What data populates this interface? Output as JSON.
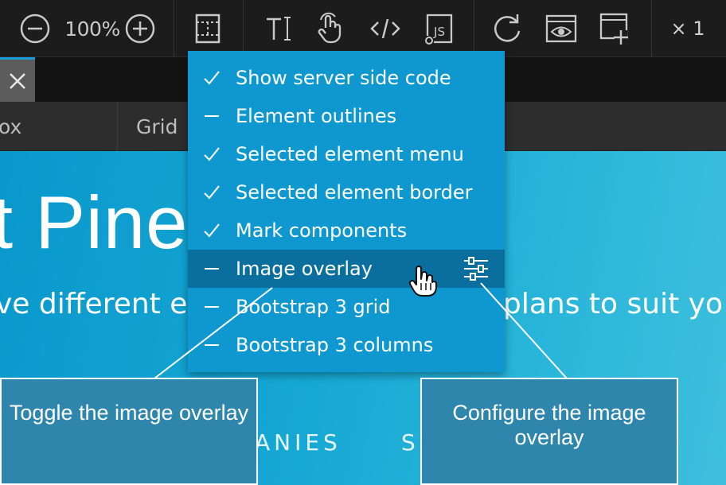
{
  "toolbar": {
    "zoom_level": "100%",
    "multiplier": "× 1",
    "icons": [
      "zoom-out-icon",
      "zoom-in-icon",
      "page-layout-icon",
      "text-edit-icon",
      "interact-hand-icon",
      "code-icon",
      "javascript-icon",
      "refresh-icon",
      "preview-icon",
      "add-page-icon"
    ]
  },
  "subbar": {
    "item_left": "ox",
    "item_grid": "Grid"
  },
  "hero": {
    "title": "t Pine",
    "subtitle_left": "ve different ed",
    "subtitle_right": "plans to suit yo",
    "nav_left": "ANIES",
    "nav_right": "S"
  },
  "menu": {
    "items": [
      {
        "label": "Show server side code",
        "checked": true
      },
      {
        "label": "Element outlines",
        "checked": false
      },
      {
        "label": "Selected element menu",
        "checked": true
      },
      {
        "label": "Selected element border",
        "checked": true
      },
      {
        "label": "Mark components",
        "checked": true
      },
      {
        "label": "Image overlay",
        "checked": false,
        "highlighted": true
      },
      {
        "label": "Bootstrap 3 grid",
        "checked": false
      },
      {
        "label": "Bootstrap 3 columns",
        "checked": false
      }
    ]
  },
  "callouts": {
    "toggle": "Toggle the image overlay",
    "configure": "Configure the image overlay"
  },
  "colors": {
    "menu_bg": "#0e98cf",
    "menu_highlight": "#0a6f9e",
    "hero_bg": "#16a8d4",
    "callout_bg": "#2f86ad",
    "toolbar_bg": "#1c1c1c",
    "tab_accent": "#1b9bd7"
  }
}
